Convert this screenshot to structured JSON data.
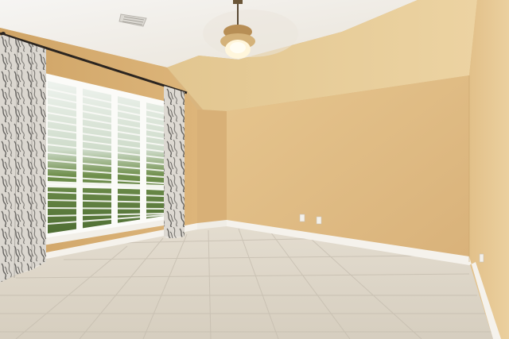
{
  "scene": {
    "kind": "photo",
    "colors": {
      "wall_left": "#d7ae6f",
      "wall_back": "#e2bd85",
      "wall_right": "#e6c896",
      "ceiling": "#f2efe9",
      "floor": "#d9d2c4",
      "baseboard": "#f5f2ec",
      "trim": "#fbfbf8"
    },
    "icons": [
      "ceiling-fan-light-icon",
      "air-vent-icon",
      "outlet-icon"
    ]
  }
}
